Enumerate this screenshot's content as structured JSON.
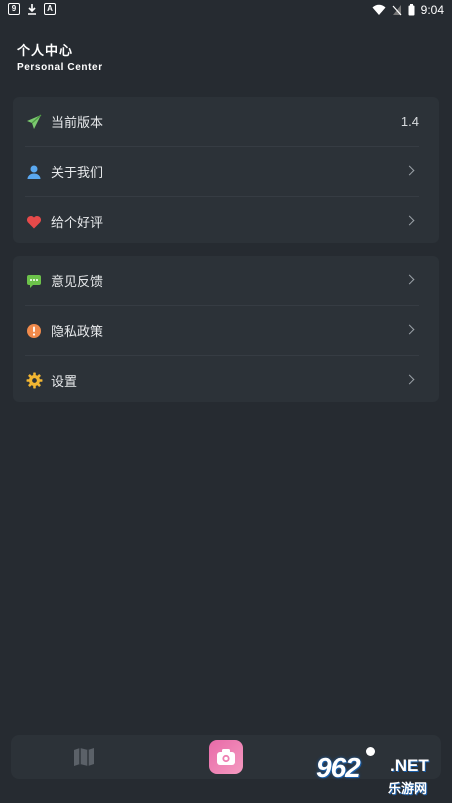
{
  "status": {
    "time": "9:04"
  },
  "header": {
    "title": "个人中心",
    "subtitle": "Personal Center"
  },
  "group1": {
    "items": [
      {
        "label": "当前版本",
        "value": "1.4",
        "icon": "paper-plane-icon"
      },
      {
        "label": "关于我们",
        "icon": "user-icon"
      },
      {
        "label": "给个好评",
        "icon": "heart-icon"
      }
    ]
  },
  "group2": {
    "items": [
      {
        "label": "意见反馈",
        "icon": "message-icon"
      },
      {
        "label": "隐私政策",
        "icon": "alert-icon"
      },
      {
        "label": "设置",
        "icon": "gear-icon"
      }
    ]
  },
  "tabs": [
    {
      "icon": "map-icon"
    },
    {
      "icon": "camera-icon"
    },
    {
      "icon": "dot-icon"
    }
  ],
  "watermark": {
    "brand": "962",
    "domain": ".NET",
    "caption": "乐游网"
  },
  "colors": {
    "background": "#262b31",
    "card": "#2c3238",
    "camera_tab": "#ee7fb2"
  }
}
